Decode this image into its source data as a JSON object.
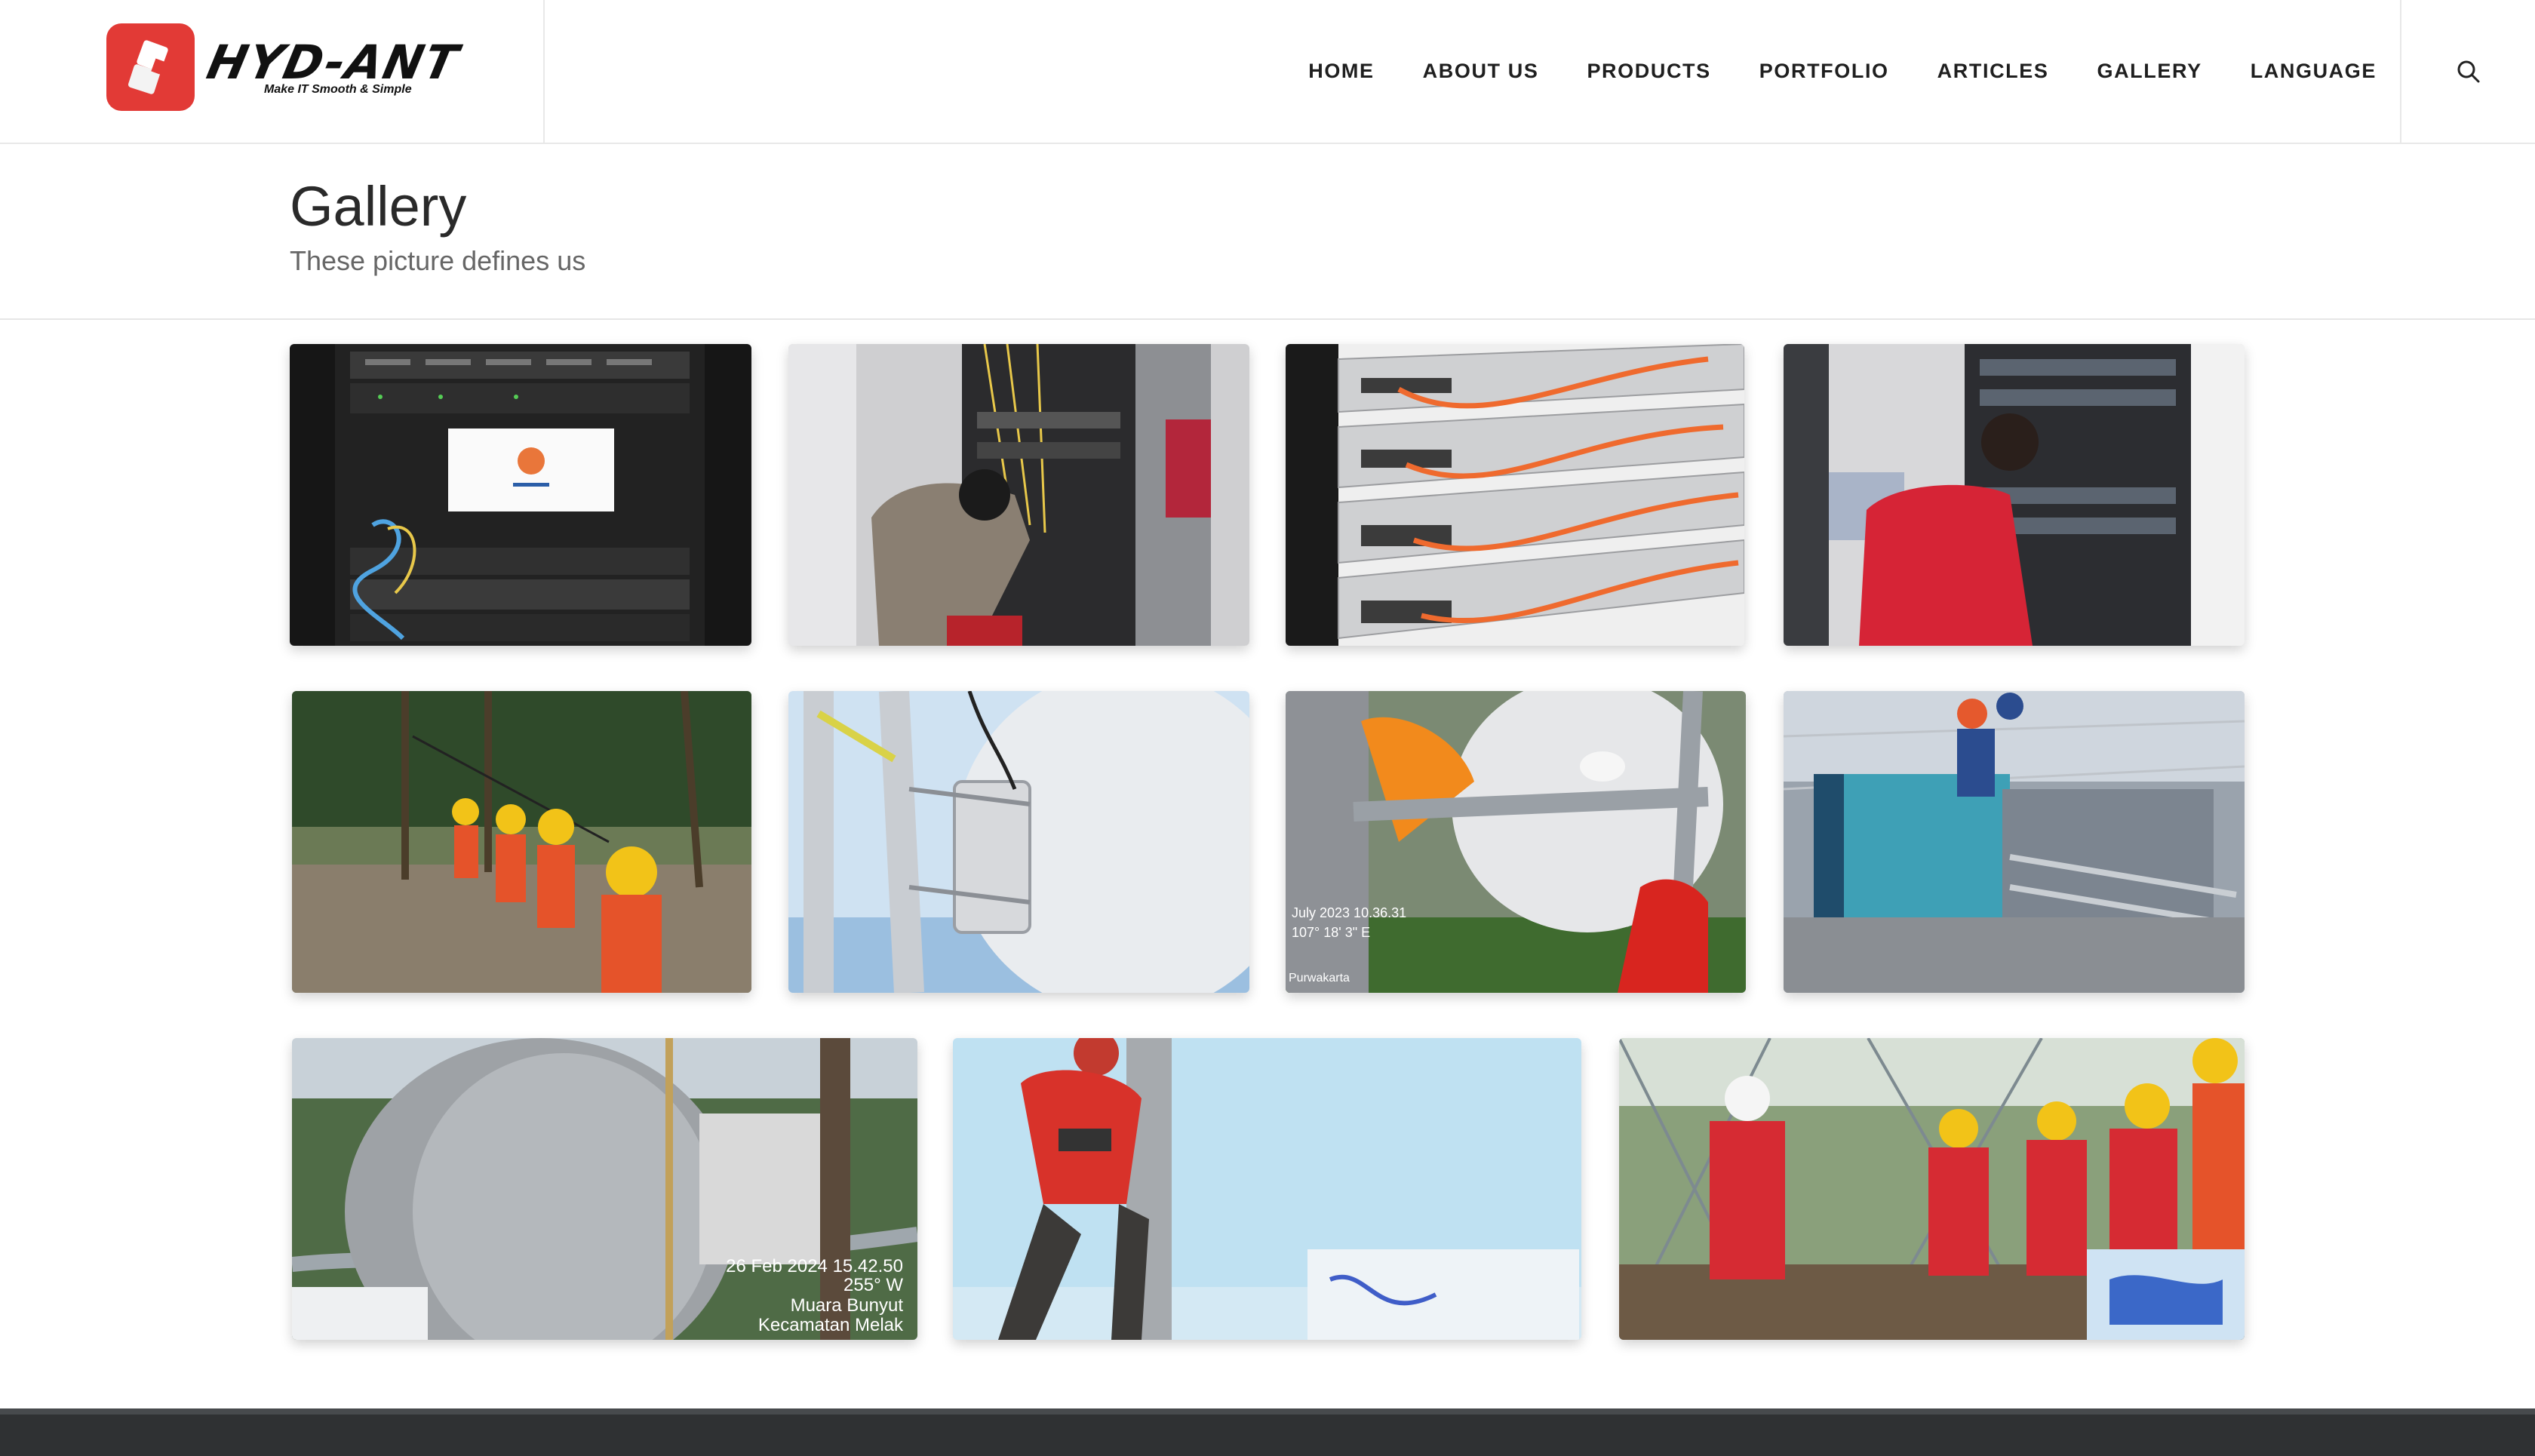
{
  "brand": {
    "name": "HYD-ANT",
    "tagline": "Make IT Smooth & Simple",
    "color": "#e23a36"
  },
  "nav": {
    "items": [
      {
        "label": "HOME"
      },
      {
        "label": "ABOUT US"
      },
      {
        "label": "PRODUCTS"
      },
      {
        "label": "PORTFOLIO"
      },
      {
        "label": "ARTICLES"
      },
      {
        "label": "GALLERY"
      },
      {
        "label": "LANGUAGE"
      }
    ],
    "search_icon": "search-icon"
  },
  "page": {
    "title": "Gallery",
    "subtitle": "These picture defines us"
  },
  "gallery": {
    "photos": [
      {
        "name": "photo-server-rack-monitor"
      },
      {
        "name": "photo-technician-cabling-rack"
      },
      {
        "name": "photo-network-switches-orange-cables"
      },
      {
        "name": "photo-technician-red-shirt-rack"
      },
      {
        "name": "photo-workers-yellow-helmets-field"
      },
      {
        "name": "photo-antenna-mount-pole"
      },
      {
        "name": "photo-antenna-dish-installation",
        "overlay": [
          "July 2023 10.36.31",
          "107° 18' 3\" E",
          "Purwakarta"
        ]
      },
      {
        "name": "photo-generator-tower-site"
      },
      {
        "name": "photo-large-dish-antenna-aerial",
        "overlay": [
          "26 Feb 2024 15.42.50",
          "255° W",
          "Muara Bunyut",
          "Kecamatan Melak"
        ]
      },
      {
        "name": "photo-climber-on-pole"
      },
      {
        "name": "photo-team-red-uniforms-tower"
      }
    ]
  }
}
